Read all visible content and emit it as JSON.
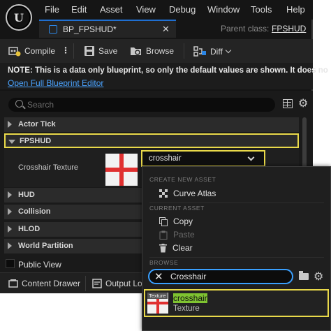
{
  "menubar": {
    "logo": "unreal-logo",
    "items": [
      "File",
      "Edit",
      "Asset",
      "View",
      "Debug",
      "Window",
      "Tools",
      "Help"
    ]
  },
  "tab": {
    "label": "BP_FPSHUD*",
    "icon": "blueprint-icon",
    "parent_label": "Parent class:",
    "parent_value": "FPSHUD"
  },
  "toolbar": {
    "compile": "Compile",
    "save": "Save",
    "browse": "Browse",
    "diff": "Diff"
  },
  "note": {
    "text": "NOTE: This is a data only blueprint, so only the default values are shown.  It does no",
    "link": "Open Full Blueprint Editor"
  },
  "details": {
    "search_placeholder": "Search",
    "categories": [
      "Actor Tick",
      "FPSHUD",
      "HUD",
      "Collision",
      "HLOD",
      "World Partition"
    ],
    "property_label": "Crosshair Texture",
    "property_value": "crosshair",
    "public_view": "Public View"
  },
  "statusbar": {
    "content_drawer": "Content Drawer",
    "output_log": "Output Log"
  },
  "popup": {
    "create_header": "CREATE NEW ASSET",
    "create_item": "Curve Atlas",
    "current_header": "CURRENT ASSET",
    "copy": "Copy",
    "paste": "Paste",
    "clear": "Clear",
    "browse_header": "BROWSE",
    "search_value": "Crosshair",
    "result_tag": "Texture",
    "result_name": "crosshair",
    "result_type": "Texture"
  },
  "colors": {
    "highlight_outline": "#e9d94a",
    "search_focus": "#3aa0ff",
    "match_highlight": "#7fc331",
    "link": "#4aa3ff"
  }
}
